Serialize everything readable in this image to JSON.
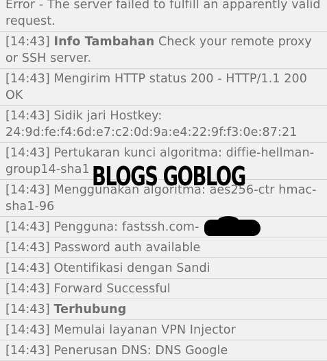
{
  "log": {
    "entries": [
      {
        "time": "",
        "bold": "",
        "text": "Error - The server failed to fulfill an apparently valid request."
      },
      {
        "time": "[14:43]",
        "bold": "Info Tambahan",
        "text": "Check your remote proxy or SSH server."
      },
      {
        "time": "[14:43]",
        "bold": "",
        "text": "Mengirim HTTP status 200 - HTTP/1.1 200 OK"
      },
      {
        "time": "[14:43]",
        "bold": "",
        "text": "Sidik jari Hostkey: 24:9d:fe:f4:6d:e7:c2:0d:9a:e4:22:9f:f3:0e:87:21"
      },
      {
        "time": "[14:43]",
        "bold": "",
        "text": "Pertukaran kunci algoritma: diffie-hellman-group14-sha1"
      },
      {
        "time": "[14:43]",
        "bold": "",
        "text": "Menggunakan algoritma: aes256-ctr hmac-sha1-96"
      },
      {
        "time": "[14:43]",
        "bold": "",
        "text": "Pengguna: fastssh.com-"
      },
      {
        "time": "[14:43]",
        "bold": "",
        "text": "Password auth available"
      },
      {
        "time": "[14:43]",
        "bold": "",
        "text": "Otentifikasi dengan Sandi"
      },
      {
        "time": "[14:43]",
        "bold": "",
        "text": "Forward Successful"
      },
      {
        "time": "[14:43]",
        "bold": "Terhubung",
        "text": ""
      },
      {
        "time": "[14:43]",
        "bold": "",
        "text": "Memulai layanan VPN Injector"
      },
      {
        "time": "[14:43]",
        "bold": "",
        "text": "Penerusan DNS: DNS Google"
      }
    ]
  },
  "watermark": {
    "text": "BLOGS GOBLOG",
    "color": "#000000"
  }
}
